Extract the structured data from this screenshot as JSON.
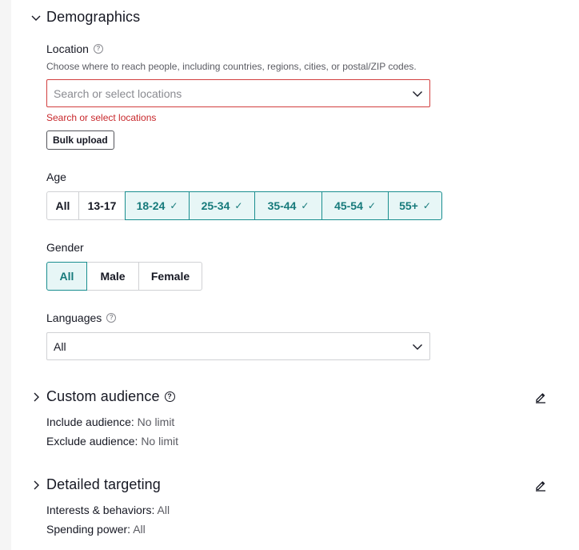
{
  "demographics": {
    "title": "Demographics",
    "location": {
      "label": "Location",
      "description": "Choose where to reach people, including countries, regions, cities, or postal/ZIP codes.",
      "placeholder": "Search or select locations",
      "error": "Search or select locations",
      "bulk_upload": "Bulk upload"
    },
    "age": {
      "label": "Age",
      "options": [
        "All",
        "13-17",
        "18-24",
        "25-34",
        "35-44",
        "45-54",
        "55+"
      ]
    },
    "gender": {
      "label": "Gender",
      "options": [
        "All",
        "Male",
        "Female"
      ]
    },
    "languages": {
      "label": "Languages",
      "value": "All"
    }
  },
  "custom_audience": {
    "title": "Custom audience",
    "include_label": "Include audience:",
    "include_value": "No limit",
    "exclude_label": "Exclude audience:",
    "exclude_value": "No limit"
  },
  "detailed_targeting": {
    "title": "Detailed targeting",
    "interests_label": "Interests & behaviors:",
    "interests_value": "All",
    "spending_label": "Spending power:",
    "spending_value": "All"
  },
  "colors": {
    "accent": "#1a8e8f",
    "selected_bg": "#e7f6f6",
    "error": "#c8282c"
  }
}
